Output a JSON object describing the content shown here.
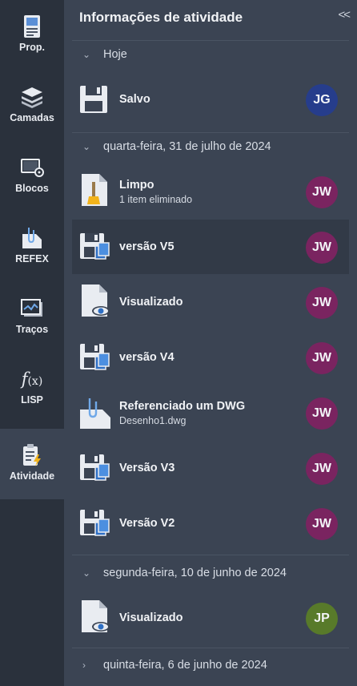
{
  "sidebar": {
    "items": [
      {
        "label": "Prop.",
        "icon": "properties-icon"
      },
      {
        "label": "Camadas",
        "icon": "layers-icon"
      },
      {
        "label": "Blocos",
        "icon": "blocks-icon"
      },
      {
        "label": "REFEX",
        "icon": "xref-icon"
      },
      {
        "label": "Traços",
        "icon": "traces-icon"
      },
      {
        "label": "LISP",
        "icon": "lisp-icon"
      },
      {
        "label": "Atividade",
        "icon": "activity-icon"
      }
    ]
  },
  "panel": {
    "title": "Informações de atividade",
    "collapse_label": "<<"
  },
  "sections": [
    {
      "label": "Hoje",
      "expanded": true
    },
    {
      "label": "quarta-feira, 31 de julho de 2024",
      "expanded": true
    },
    {
      "label": "segunda-feira, 10 de junho de 2024",
      "expanded": true
    },
    {
      "label": "quinta-feira, 6 de junho de 2024",
      "expanded": false
    }
  ],
  "activities": [
    {
      "title": "Salvo",
      "subtitle": "",
      "icon": "save-icon",
      "user": "JG",
      "user_color": "#263d8c"
    },
    {
      "title": "Limpo",
      "subtitle": "1 item eliminado",
      "icon": "purge-icon",
      "user": "JW",
      "user_color": "#7a2460"
    },
    {
      "title": "versão V5",
      "subtitle": "",
      "icon": "version-icon",
      "user": "JW",
      "user_color": "#7a2460"
    },
    {
      "title": "Visualizado",
      "subtitle": "",
      "icon": "viewed-icon",
      "user": "JW",
      "user_color": "#7a2460"
    },
    {
      "title": "versão V4",
      "subtitle": "",
      "icon": "version-icon",
      "user": "JW",
      "user_color": "#7a2460"
    },
    {
      "title": "Referenciado um DWG",
      "subtitle": "Desenho1.dwg",
      "icon": "xref-dwg-icon",
      "user": "JW",
      "user_color": "#7a2460"
    },
    {
      "title": "Versão V3",
      "subtitle": "",
      "icon": "version-icon",
      "user": "JW",
      "user_color": "#7a2460"
    },
    {
      "title": "Versão V2",
      "subtitle": "",
      "icon": "version-icon",
      "user": "JW",
      "user_color": "#7a2460"
    },
    {
      "title": "Visualizado",
      "subtitle": "",
      "icon": "viewed-icon",
      "user": "JP",
      "user_color": "#587a2a"
    }
  ]
}
